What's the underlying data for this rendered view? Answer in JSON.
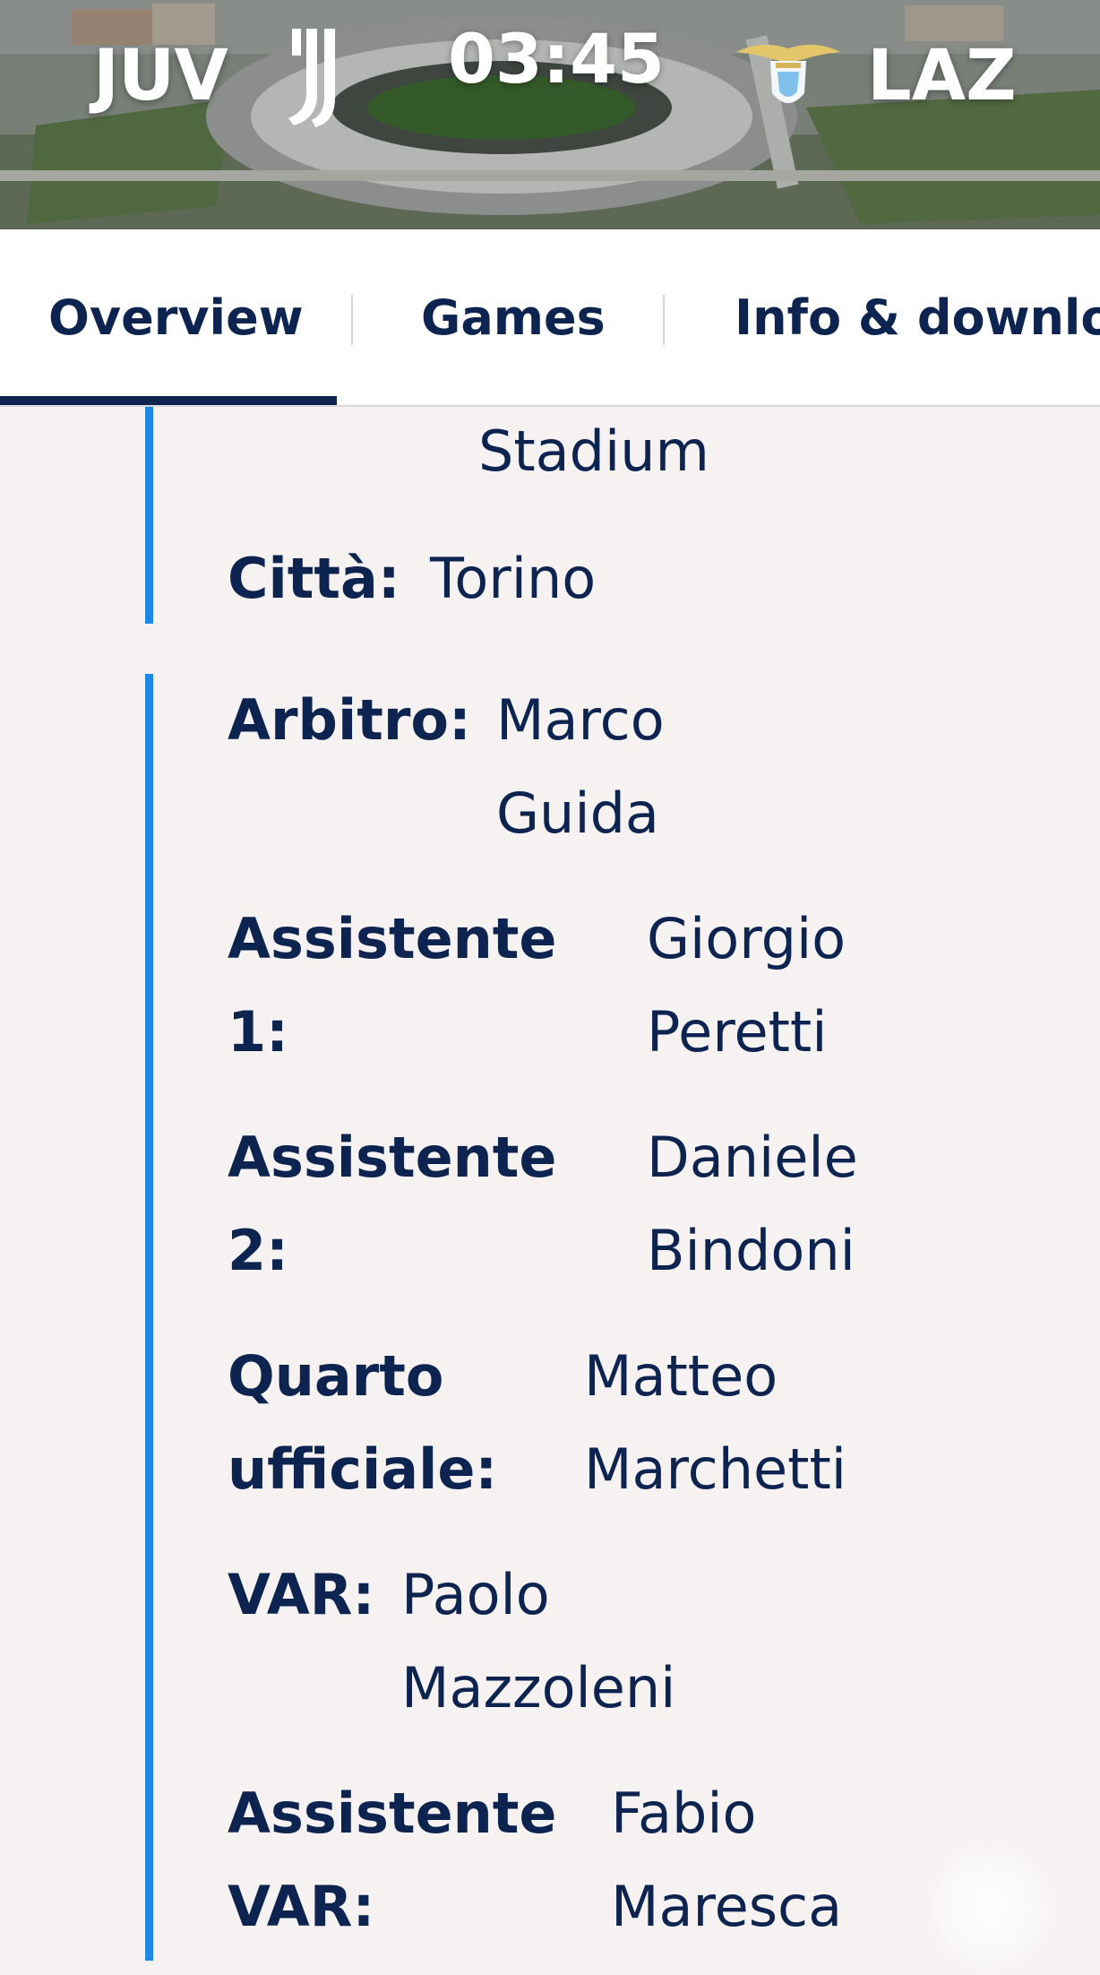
{
  "header": {
    "home_team": "JUV",
    "away_team": "LAZ",
    "clock": "03:45",
    "home_logo": "juventus-logo",
    "away_logo": "lazio-logo"
  },
  "tabs": [
    {
      "label": "Overview",
      "active": true
    },
    {
      "label": "Games",
      "active": false
    },
    {
      "label": "Info & downloa",
      "active": false
    }
  ],
  "venue": {
    "stadium_tail": "Stadium",
    "city_label": "Città:",
    "city_value": "Torino"
  },
  "officials": [
    {
      "label_lines": [
        "Arbitro:"
      ],
      "value_lines": [
        "Marco",
        "Guida"
      ]
    },
    {
      "label_lines": [
        "Assistente 1:"
      ],
      "value_lines": [
        "Giorgio",
        "Peretti"
      ]
    },
    {
      "label_lines": [
        "Assistente",
        "2:"
      ],
      "value_lines": [
        "Daniele",
        "Bindoni"
      ]
    },
    {
      "label_lines": [
        "Quarto",
        "ufficiale:"
      ],
      "value_lines": [
        "Matteo",
        "Marchetti"
      ]
    },
    {
      "label_lines": [
        "VAR:"
      ],
      "value_lines": [
        "Paolo",
        "Mazzoleni"
      ]
    },
    {
      "label_lines": [
        "Assistente",
        "VAR:"
      ],
      "value_lines": [
        "Fabio",
        "Maresca"
      ]
    }
  ],
  "colors": {
    "navy": "#0d2350",
    "accent_blue": "#1e88e5",
    "background": "#f5f2f1"
  }
}
